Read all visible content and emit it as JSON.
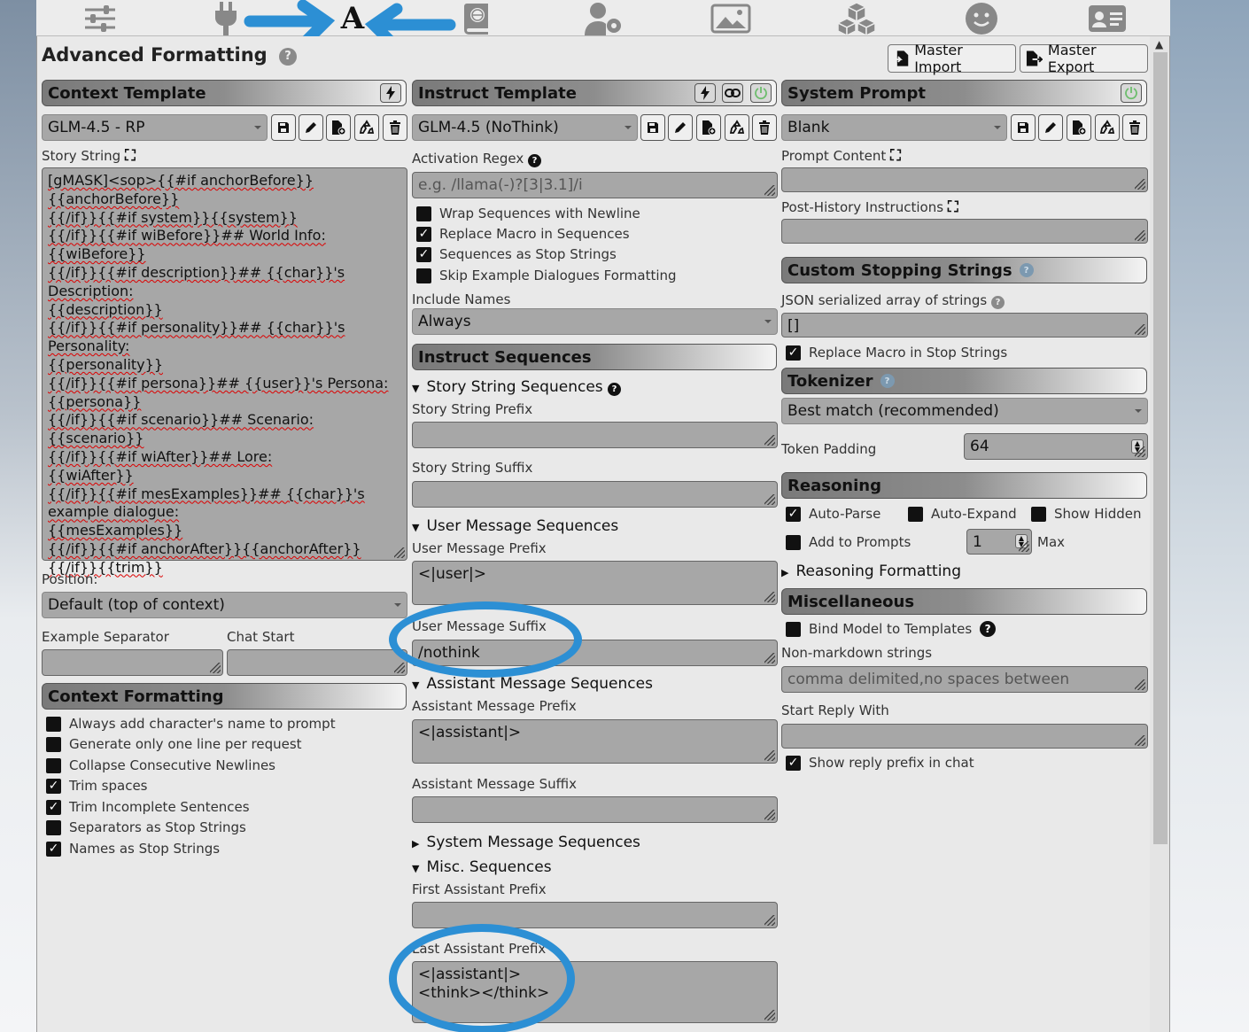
{
  "app": {
    "title": "Advanced Formatting"
  },
  "topnav": {
    "icons": [
      "sliders-icon",
      "plug-icon",
      "font-a-icon",
      "book-globe-icon",
      "user-gear-icon",
      "image-icon",
      "cubes-icon",
      "smile-icon",
      "id-card-icon"
    ],
    "active_letter": "A"
  },
  "header": {
    "master_import": "Master Import",
    "master_export": "Master Export"
  },
  "context_template": {
    "title": "Context Template",
    "selected": "GLM-4.5 - RP",
    "story_string_label": "Story String",
    "story_string": "[gMASK]<sop>{{#if anchorBefore}}\n{{anchorBefore}}\n{{/if}}{{#if system}}{{system}}\n{{/if}}{{#if wiBefore}}## World Info:\n{{wiBefore}}\n{{/if}}{{#if description}}## {{char}}'s Description:\n{{description}}\n{{/if}}{{#if personality}}## {{char}}'s Personality:\n{{personality}}\n{{/if}}{{#if persona}}## {{user}}'s Persona:\n{{persona}}\n{{/if}}{{#if scenario}}## Scenario:\n{{scenario}}\n{{/if}}{{#if wiAfter}}## Lore:\n{{wiAfter}}\n{{/if}}{{#if mesExamples}}## {{char}}'s example dialogue:\n{{mesExamples}}\n{{/if}}{{#if anchorAfter}}{{anchorAfter}}\n{{/if}}{{trim}}",
    "position_label": "Position:",
    "position_value": "Default (top of context)",
    "example_separator_label": "Example Separator",
    "chat_start_label": "Chat Start"
  },
  "context_formatting": {
    "title": "Context Formatting",
    "options": [
      {
        "label": "Always add character's name to prompt",
        "checked": false
      },
      {
        "label": "Generate only one line per request",
        "checked": false
      },
      {
        "label": "Collapse Consecutive Newlines",
        "checked": false
      },
      {
        "label": "Trim spaces",
        "checked": true
      },
      {
        "label": "Trim Incomplete Sentences",
        "checked": true
      },
      {
        "label": "Separators as Stop Strings",
        "checked": false
      },
      {
        "label": "Names as Stop Strings",
        "checked": true
      }
    ]
  },
  "instruct_template": {
    "title": "Instruct Template",
    "selected": "GLM-4.5 (NoThink)",
    "activation_regex_label": "Activation Regex",
    "activation_regex_placeholder": "e.g. /llama(-)?[3|3.1]/i",
    "options": [
      {
        "label": "Wrap Sequences with Newline",
        "checked": false
      },
      {
        "label": "Replace Macro in Sequences",
        "checked": true
      },
      {
        "label": "Sequences as Stop Strings",
        "checked": true
      },
      {
        "label": "Skip Example Dialogues Formatting",
        "checked": false
      }
    ],
    "include_names_label": "Include Names",
    "include_names_value": "Always"
  },
  "instruct_sequences": {
    "title": "Instruct Sequences",
    "story_string_sequences": "Story String Sequences",
    "story_string_prefix": "Story String Prefix",
    "story_string_suffix": "Story String Suffix",
    "user_message_sequences": "User Message Sequences",
    "user_message_prefix_label": "User Message Prefix",
    "user_message_prefix": "<|user|>",
    "user_message_suffix_label": "User Message Suffix",
    "user_message_suffix": "/nothink",
    "assistant_message_sequences": "Assistant Message Sequences",
    "assistant_message_prefix_label": "Assistant Message Prefix",
    "assistant_message_prefix": "<|assistant|>",
    "assistant_message_suffix_label": "Assistant Message Suffix",
    "system_message_sequences": "System Message Sequences",
    "misc_sequences": "Misc. Sequences",
    "first_assistant_prefix_label": "First Assistant Prefix",
    "last_assistant_prefix_label": "Last Assistant Prefix",
    "last_assistant_prefix": "<|assistant|>\n<think></think>"
  },
  "system_prompt": {
    "title": "System Prompt",
    "selected": "Blank",
    "prompt_content_label": "Prompt Content",
    "post_history_label": "Post-History Instructions"
  },
  "custom_stopping_strings": {
    "title": "Custom Stopping Strings",
    "json_label": "JSON serialized array of strings",
    "json_value": "[]",
    "replace_macro_label": "Replace Macro in Stop Strings",
    "replace_macro_checked": true
  },
  "tokenizer": {
    "title": "Tokenizer",
    "selected": "Best match (recommended)",
    "token_padding_label": "Token Padding",
    "token_padding_value": "64"
  },
  "reasoning": {
    "title": "Reasoning",
    "auto_parse": "Auto-Parse",
    "auto_parse_checked": true,
    "auto_expand": "Auto-Expand",
    "auto_expand_checked": false,
    "show_hidden": "Show Hidden",
    "show_hidden_checked": false,
    "add_to_prompts": "Add to Prompts",
    "add_to_prompts_checked": false,
    "max_value": "1",
    "max_label": "Max",
    "reasoning_formatting": "Reasoning Formatting"
  },
  "misc": {
    "title": "Miscellaneous",
    "bind_model_label": "Bind Model to Templates",
    "non_markdown_label": "Non-markdown strings",
    "non_markdown_placeholder": "comma delimited,no spaces between",
    "start_reply_label": "Start Reply With",
    "show_reply_prefix_label": "Show reply prefix in chat",
    "show_reply_prefix_checked": true
  },
  "colors": {
    "annotation": "#2c8fd4",
    "panel_bg": "#e9e9e9",
    "field_bg": "#a7a7a7"
  }
}
